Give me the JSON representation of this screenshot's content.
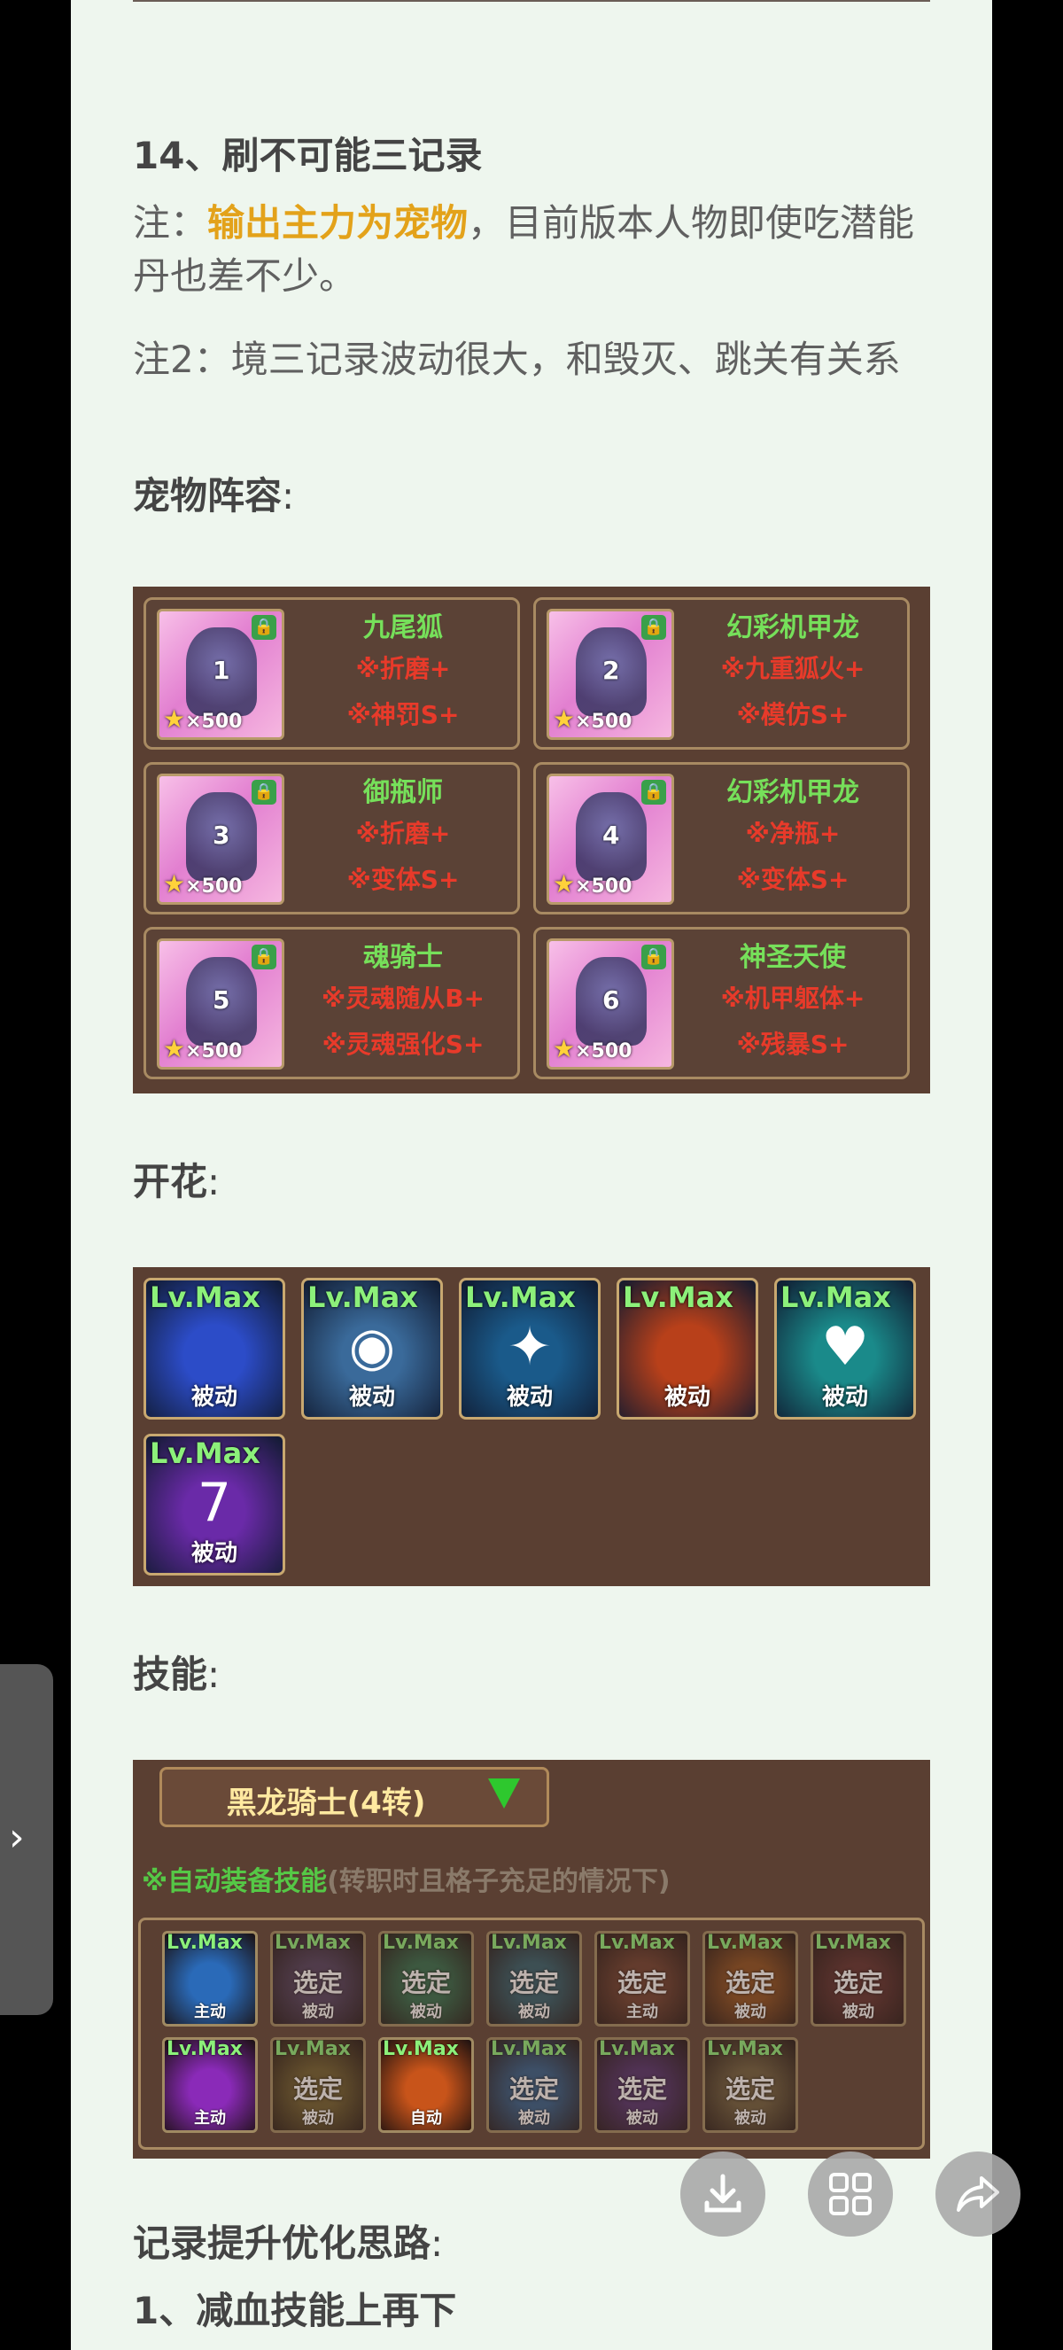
{
  "section": {
    "title": "14、刷不可能三记录",
    "note1_prefix": "注：",
    "note1_highlight": "输出主力为宠物",
    "note1_rest": "，目前版本人物即使吃潜能丹也差不少。",
    "note2": "注2：境三记录波动很大，和毁灭、跳关有关系",
    "pet_lineup_label": "宠物阵容",
    "flower_label": "开花",
    "skill_label": "技能",
    "record_label": "记录提升优化思路",
    "tip1": "1、减血技能上再下",
    "colon": ":"
  },
  "pets": [
    {
      "num": "1",
      "name": "九尾狐",
      "skill1": "※折磨+",
      "skill2": "※神罚S+",
      "stars": "×500"
    },
    {
      "num": "2",
      "name": "幻彩机甲龙",
      "skill1": "※九重狐火+",
      "skill2": "※模仿S+",
      "stars": "×500"
    },
    {
      "num": "3",
      "name": "御瓶师",
      "skill1": "※折磨+",
      "skill2": "※变体S+",
      "stars": "×500"
    },
    {
      "num": "4",
      "name": "幻彩机甲龙",
      "skill1": "※净瓶+",
      "skill2": "※变体S+",
      "stars": "×500"
    },
    {
      "num": "5",
      "name": "魂骑士",
      "skill1": "※灵魂随从B+",
      "skill2": "※灵魂强化S+",
      "stars": "×500"
    },
    {
      "num": "6",
      "name": "神圣天使",
      "skill1": "※机甲躯体+",
      "skill2": "※残暴S+",
      "stars": "×500"
    }
  ],
  "flowers": [
    {
      "lv": "Lv.Max",
      "type": "被动",
      "bg": "#2c4cc8",
      "glyph": ""
    },
    {
      "lv": "Lv.Max",
      "type": "被动",
      "bg": "#3a6a9a",
      "glyph": "◉"
    },
    {
      "lv": "Lv.Max",
      "type": "被动",
      "bg": "#1a5a8a",
      "glyph": "✦"
    },
    {
      "lv": "Lv.Max",
      "type": "被动",
      "bg": "#b8401a",
      "glyph": ""
    },
    {
      "lv": "Lv.Max",
      "type": "被动",
      "bg": "#1a8a8a",
      "glyph": "♥"
    },
    {
      "lv": "Lv.Max",
      "type": "被动",
      "bg": "#6a2aa8",
      "glyph": "7"
    }
  ],
  "skill_panel": {
    "header": "黑龙骑士(4转)",
    "auto_note": "※自动装备技能",
    "auto_note_dim": "(转职时且格子充足的情况下)"
  },
  "skills": [
    {
      "lv": "Lv.Max",
      "sel": "",
      "type": "主动",
      "bg": "#2a6ab8",
      "dim": false
    },
    {
      "lv": "Lv.Max",
      "sel": "选定",
      "type": "被动",
      "bg": "#4a3a5a",
      "dim": true
    },
    {
      "lv": "Lv.Max",
      "sel": "选定",
      "type": "被动",
      "bg": "#2a6a4a",
      "dim": true
    },
    {
      "lv": "Lv.Max",
      "sel": "选定",
      "type": "被动",
      "bg": "#2a5a6a",
      "dim": true
    },
    {
      "lv": "Lv.Max",
      "sel": "选定",
      "type": "主动",
      "bg": "#6a3a2a",
      "dim": true
    },
    {
      "lv": "Lv.Max",
      "sel": "选定",
      "type": "被动",
      "bg": "#8a4a1a",
      "dim": true
    },
    {
      "lv": "Lv.Max",
      "sel": "选定",
      "type": "被动",
      "bg": "#5a2a2a",
      "dim": true
    },
    {
      "lv": "Lv.Max",
      "sel": "",
      "type": "主动",
      "bg": "#8a2ab8",
      "dim": false
    },
    {
      "lv": "Lv.Max",
      "sel": "选定",
      "type": "被动",
      "bg": "#6a5a2a",
      "dim": true
    },
    {
      "lv": "Lv.Max",
      "sel": "",
      "type": "自动",
      "bg": "#c8541a",
      "dim": false
    },
    {
      "lv": "Lv.Max",
      "sel": "选定",
      "type": "被动",
      "bg": "#2a5a8a",
      "dim": true
    },
    {
      "lv": "Lv.Max",
      "sel": "选定",
      "type": "被动",
      "bg": "#4a2a6a",
      "dim": true
    },
    {
      "lv": "Lv.Max",
      "sel": "选定",
      "type": "被动",
      "bg": "#6a5a3a",
      "dim": true
    }
  ]
}
